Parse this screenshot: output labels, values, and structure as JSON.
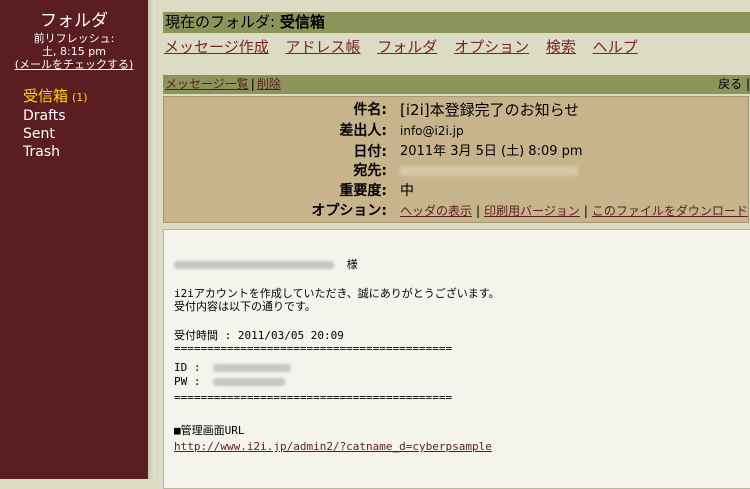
{
  "sidebar": {
    "title": "フォルダ",
    "refresh_label": "前リフレッシュ:",
    "refresh_time": "土, 8:15 pm",
    "check_mail": "(メールをチェックする)",
    "folders": [
      {
        "name": "受信箱",
        "count": "(1)",
        "active": true
      },
      {
        "name": "Drafts"
      },
      {
        "name": "Sent"
      },
      {
        "name": "Trash"
      }
    ]
  },
  "current_folder": {
    "label": "現在のフォルダ:",
    "name": "受信箱"
  },
  "nav": {
    "items": [
      "メッセージ作成",
      "アドレス帳",
      "フォルダ",
      "オプション",
      "検索",
      "ヘルプ"
    ]
  },
  "toolbar": {
    "message_list": "メッセージ一覧",
    "delete": "削除",
    "back": "戻る"
  },
  "message_headers": {
    "subject_label": "件名:",
    "subject": "[i2i]本登録完了のお知らせ",
    "from_label": "差出人:",
    "from": "info@i2i.jp",
    "date_label": "日付:",
    "date": "2011年 3月 5日 (土) 8:09 pm",
    "to_label": "宛先:",
    "priority_label": "重要度:",
    "priority": "中",
    "options_label": "オプション:",
    "options": [
      "ヘッダの表示",
      "印刷用バージョン",
      "このファイルをダウンロード"
    ]
  },
  "message_body": {
    "salutation_suffix": "様",
    "line1": "i2iアカウントを作成していただき、誠にありがとうございます。",
    "line2": "受付内容は以下の通りです。",
    "time_line": "受付時間 : 2011/03/05 20:09",
    "separator": "==========================================",
    "id_label": "ID :",
    "pw_label": "PW :",
    "admin_heading": "■管理画面URL",
    "admin_url": "http://www.i2i.jp/admin2/?catname_d=cyberpsample"
  }
}
